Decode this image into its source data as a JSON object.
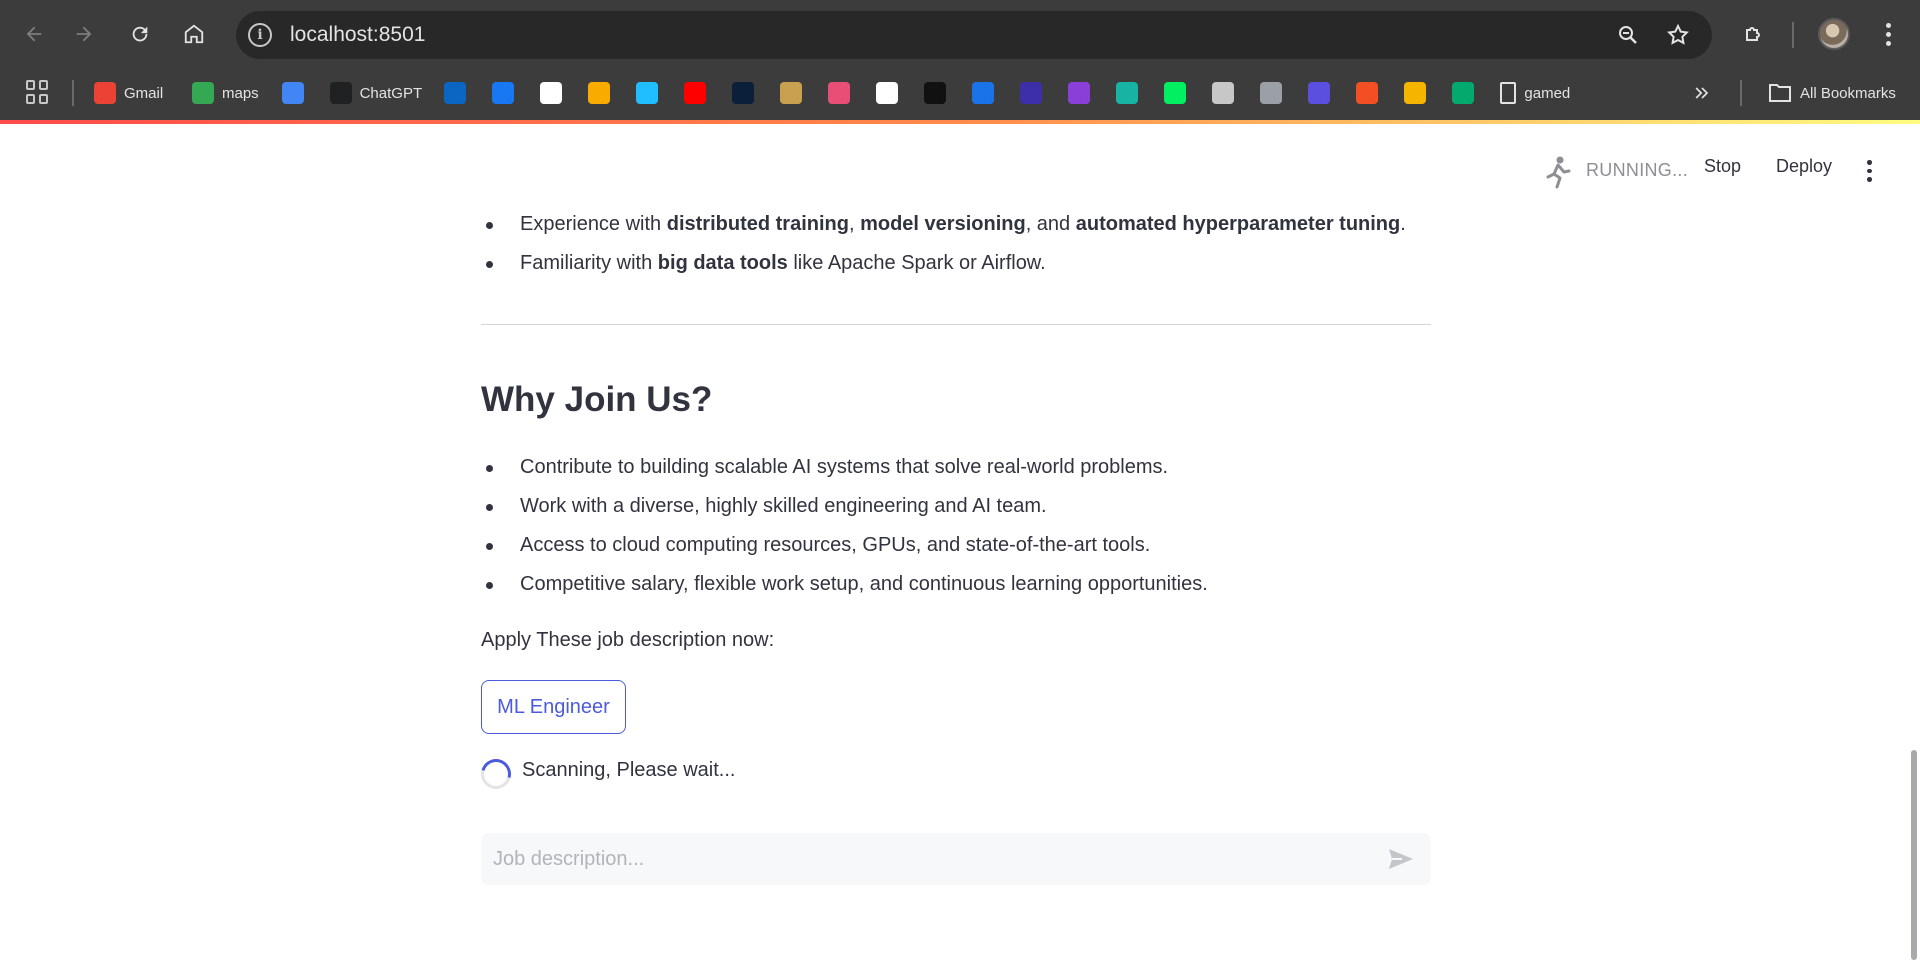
{
  "browser": {
    "url": "localhost:8501",
    "bookmarks": [
      {
        "label": "Gmail",
        "icon": "gmail-icon",
        "color": "#ea4335"
      },
      {
        "label": "maps",
        "icon": "maps-icon",
        "color": "#34a853"
      },
      {
        "label": "",
        "icon": "translate-icon",
        "color": "#4285f4"
      },
      {
        "label": "ChatGPT",
        "icon": "chatgpt-icon",
        "color": "#202123"
      },
      {
        "label": "",
        "icon": "linkedin-icon",
        "color": "#0a66c2"
      },
      {
        "label": "",
        "icon": "facebook-icon",
        "color": "#1877f2"
      },
      {
        "label": "",
        "icon": "github-icon",
        "color": "#ffffff"
      },
      {
        "label": "",
        "icon": "colab-icon",
        "color": "#f9ab00"
      },
      {
        "label": "",
        "icon": "k-icon",
        "color": "#20beff"
      },
      {
        "label": "",
        "icon": "youtube-icon",
        "color": "#ff0000"
      },
      {
        "label": "",
        "icon": "chart-icon",
        "color": "#0b1e3a"
      },
      {
        "label": "",
        "icon": "figure-icon",
        "color": "#c8a050"
      },
      {
        "label": "",
        "icon": "swirl-icon",
        "color": "#e94e77"
      },
      {
        "label": "",
        "icon": "google-icon",
        "color": "#ffffff"
      },
      {
        "label": "",
        "icon": "hackerrank-icon",
        "color": "#111111"
      },
      {
        "label": "",
        "icon": "c-icon",
        "color": "#1a73e8"
      },
      {
        "label": "",
        "icon": "w-icon",
        "color": "#3c2fa8"
      },
      {
        "label": "",
        "icon": "u-icon",
        "color": "#8b3fd9"
      },
      {
        "label": "",
        "icon": "k2-icon",
        "color": "#17b3a3"
      },
      {
        "label": "",
        "icon": "dc-icon",
        "color": "#03ef62"
      },
      {
        "label": "",
        "icon": "globe-icon",
        "color": "#c7c7c7"
      },
      {
        "label": "",
        "icon": "cisco-icon",
        "color": "#9aa0a6"
      },
      {
        "label": "",
        "icon": "dot-icon",
        "color": "#5b4fe0"
      },
      {
        "label": "",
        "icon": "microsoft-icon",
        "color": "#f25022"
      },
      {
        "label": "",
        "icon": "bars-icon",
        "color": "#f4b400"
      },
      {
        "label": "",
        "icon": "w3-icon",
        "color": "#04aa6d"
      },
      {
        "label": "gamed",
        "icon": "file-icon",
        "color": "#e3e3e3"
      }
    ],
    "all_bookmarks": "All Bookmarks"
  },
  "app": {
    "status": "RUNNING...",
    "stop": "Stop",
    "deploy": "Deploy",
    "requirements": [
      {
        "pre": "Experience with ",
        "b1": "distributed training",
        "m1": ", ",
        "b2": "model versioning",
        "m2": ", and ",
        "b3": "automated hyperparameter tuning",
        "post": "."
      },
      {
        "pre": "Familiarity with ",
        "b1": "big data tools",
        "post": " like Apache Spark or Airflow."
      }
    ],
    "why_title": "Why Join Us?",
    "why_items": [
      "Contribute to building scalable AI systems that solve real-world problems.",
      "Work with a diverse, highly skilled engineering and AI team.",
      "Access to cloud computing resources, GPUs, and state-of-the-art tools.",
      "Competitive salary, flexible work setup, and continuous learning opportunities."
    ],
    "apply_text": "Apply These job description now:",
    "job_button": "ML Engineer",
    "scanning": "Scanning, Please wait...",
    "input_placeholder": "Job description...",
    "accent": "#4b5bdc"
  }
}
